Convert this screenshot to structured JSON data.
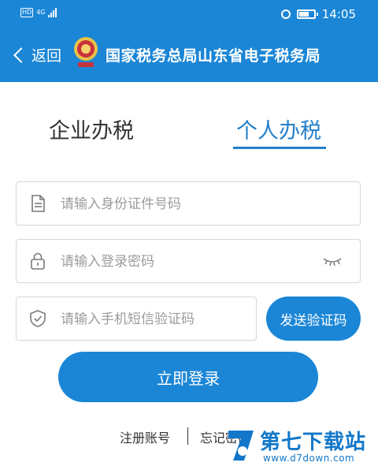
{
  "status_bar": {
    "hd_label": "HD",
    "network": "4G",
    "time": "14:05"
  },
  "nav": {
    "back_label": "返回",
    "title": "国家税务总局山东省电子税务局"
  },
  "tabs": [
    {
      "label": "企业办税",
      "active": false
    },
    {
      "label": "个人办税",
      "active": true
    }
  ],
  "form": {
    "id_placeholder": "请输入身份证件号码",
    "password_placeholder": "请输入登录密码",
    "sms_placeholder": "请输入手机短信验证码",
    "send_code_label": "发送验证码",
    "login_label": "立即登录"
  },
  "links": {
    "register": "注册账号",
    "forgot": "忘记密码"
  },
  "watermark": {
    "brand": "第七下载站",
    "url": "www.d7down.com"
  },
  "colors": {
    "primary": "#1b86d6",
    "active_tab": "#2580cb"
  }
}
